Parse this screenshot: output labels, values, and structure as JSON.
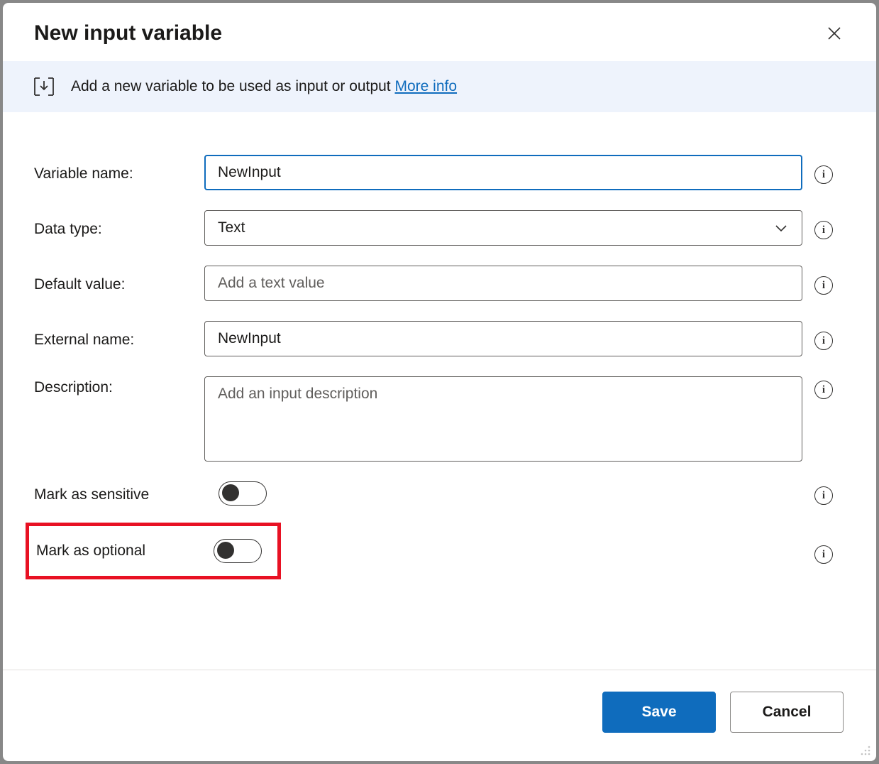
{
  "dialog": {
    "title": "New input variable",
    "close_label": "Close"
  },
  "info": {
    "text": "Add a new variable to be used as input or output ",
    "link": "More info"
  },
  "form": {
    "variable_name": {
      "label": "Variable name:",
      "value": "NewInput"
    },
    "data_type": {
      "label": "Data type:",
      "value": "Text"
    },
    "default_value": {
      "label": "Default value:",
      "value": "",
      "placeholder": "Add a text value"
    },
    "external_name": {
      "label": "External name:",
      "value": "NewInput"
    },
    "description": {
      "label": "Description:",
      "value": "",
      "placeholder": "Add an input description"
    },
    "sensitive": {
      "label": "Mark as sensitive",
      "on": false
    },
    "optional": {
      "label": "Mark as optional",
      "on": false
    }
  },
  "footer": {
    "save": "Save",
    "cancel": "Cancel"
  }
}
